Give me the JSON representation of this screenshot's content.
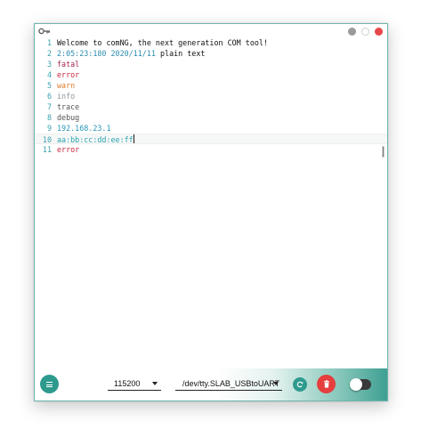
{
  "titlebar": {
    "app_icon": "key-icon",
    "buttons": [
      "minimize",
      "maximize",
      "close"
    ]
  },
  "editor": {
    "lines": [
      {
        "n": "1",
        "segments": [
          {
            "text": "Welcome to comNG, the next generation COM tool!",
            "class": "c-plain"
          }
        ]
      },
      {
        "n": "2",
        "segments": [
          {
            "text": "2:05:23:180 2020/11/11 ",
            "class": "c-time"
          },
          {
            "text": "plain text",
            "class": "c-plain"
          }
        ]
      },
      {
        "n": "3",
        "segments": [
          {
            "text": "fatal",
            "class": "c-fatal"
          }
        ]
      },
      {
        "n": "4",
        "segments": [
          {
            "text": "error",
            "class": "c-error"
          }
        ]
      },
      {
        "n": "5",
        "segments": [
          {
            "text": "warn",
            "class": "c-warn"
          }
        ]
      },
      {
        "n": "6",
        "segments": [
          {
            "text": "info",
            "class": "c-info"
          }
        ]
      },
      {
        "n": "7",
        "segments": [
          {
            "text": "trace",
            "class": "c-trace"
          }
        ]
      },
      {
        "n": "8",
        "segments": [
          {
            "text": "debug",
            "class": "c-debug"
          }
        ]
      },
      {
        "n": "9",
        "segments": [
          {
            "text": "192.168.23.1",
            "class": "c-ip"
          }
        ]
      },
      {
        "n": "10",
        "segments": [
          {
            "text": "aa:bb:cc:dd:ee:ff",
            "class": "c-mac"
          }
        ],
        "active": true
      },
      {
        "n": "11",
        "segments": [
          {
            "text": "error",
            "class": "c-error"
          }
        ]
      }
    ]
  },
  "footer": {
    "menu_icon": "menu-icon",
    "baud_rate": "115200",
    "port": "/dev/tty.SLAB_USBtoUART",
    "refresh_icon": "refresh-icon",
    "clear_icon": "trash-icon",
    "connection_toggle": "off"
  },
  "colors": {
    "accent": "#2e9a8e",
    "danger": "#e53e3e",
    "line_number": "#3aa1b0"
  }
}
